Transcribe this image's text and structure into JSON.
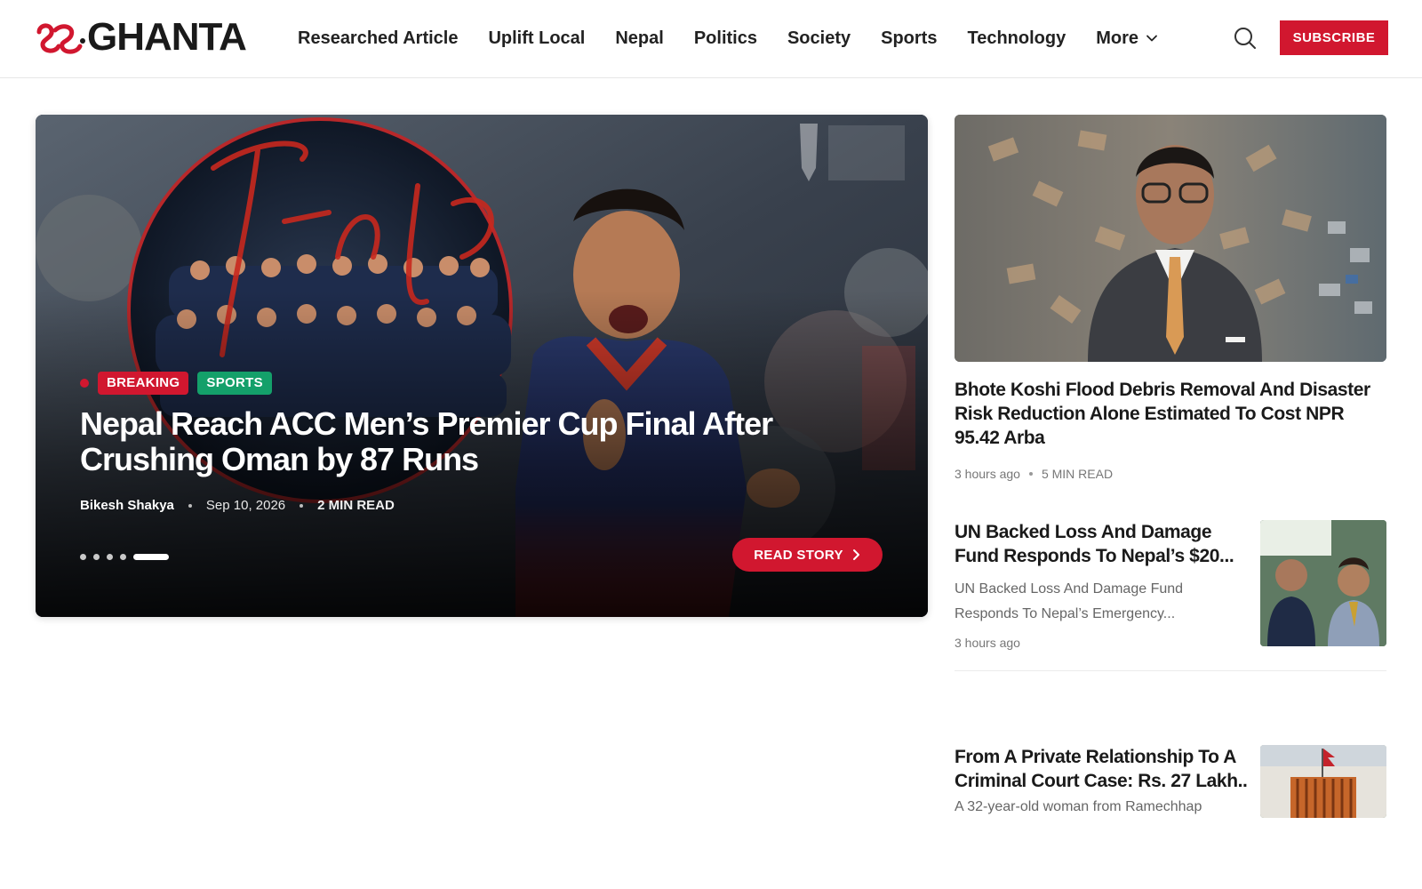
{
  "brand": {
    "logo_text": "GHANTA",
    "accent_color": "#d1172f",
    "sports_color": "#14a06a"
  },
  "nav": {
    "items": [
      "Researched Article",
      "Uplift Local",
      "Nepal",
      "Politics",
      "Society",
      "Sports",
      "Technology",
      "More"
    ],
    "more_icon": "chevron-down-icon",
    "search_icon": "search-icon",
    "subscribe_label": "SUBSCRIBE"
  },
  "hero": {
    "badges": {
      "breaking": "BREAKING",
      "category": "SPORTS"
    },
    "title": "Nepal Reach ACC Men’s Premier Cup Final After Crushing Oman by 87 Runs",
    "author": "Bikesh Shakya",
    "date": "Sep 10, 2026",
    "read_time": "2 MIN READ",
    "read_story_label": "READ STORY",
    "slider": {
      "total": 5,
      "active": 5
    }
  },
  "sidebar": {
    "featured": {
      "title": "Bhote Koshi Flood Debris Removal And Disaster Risk Reduction Alone Estimated To Cost NPR 95.42 Arba",
      "time": "3 hours ago",
      "read_time": "5 MIN READ"
    },
    "stories": [
      {
        "title_line1": "UN Backed Loss And Damage",
        "title_line2": "Fund Responds To Nepal’s $20...",
        "excerpt_line1": "UN Backed Loss And Damage Fund",
        "excerpt_line2": "Responds To Nepal’s Emergency...",
        "time": "3 hours ago"
      },
      {
        "title_line1": "From A Private Relationship To A",
        "title_line2": "Criminal Court Case: Rs. 27 Lakh...",
        "excerpt_line1": "A 32-year-old woman from Ramechhap"
      }
    ]
  }
}
